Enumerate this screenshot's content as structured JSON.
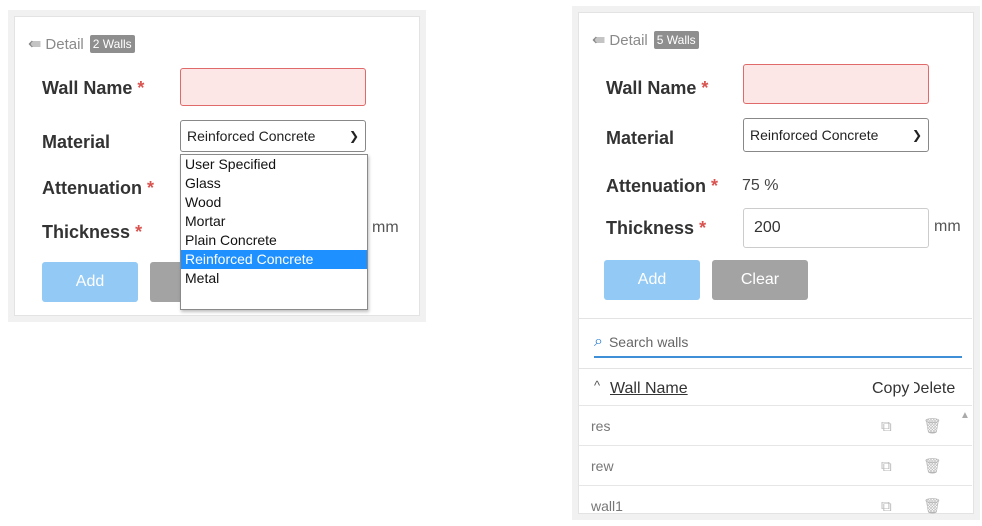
{
  "left": {
    "header": {
      "label": "Detail",
      "badge": "2 Walls"
    },
    "wall_name": {
      "label": "Wall Name",
      "required": "*",
      "value": ""
    },
    "material": {
      "label": "Material",
      "selected": "Reinforced Concrete"
    },
    "attenuation": {
      "label": "Attenuation",
      "required": "*"
    },
    "thickness": {
      "label": "Thickness",
      "required": "*",
      "unit": "mm"
    },
    "buttons": {
      "add": "Add"
    },
    "dropdown_options": [
      "User Specified",
      "Glass",
      "Wood",
      "Mortar",
      "Plain Concrete",
      "Reinforced Concrete",
      "Metal"
    ],
    "highlighted_option": "Reinforced Concrete"
  },
  "right": {
    "header": {
      "label": "Detail",
      "badge": "5 Walls"
    },
    "wall_name": {
      "label": "Wall Name",
      "required": "*",
      "value": ""
    },
    "material": {
      "label": "Material",
      "selected": "Reinforced Concrete"
    },
    "attenuation": {
      "label": "Attenuation",
      "required": "*",
      "value": "75 %"
    },
    "thickness": {
      "label": "Thickness",
      "required": "*",
      "value": "200",
      "unit": "mm"
    },
    "buttons": {
      "add": "Add",
      "clear": "Clear"
    },
    "search": {
      "placeholder": "Search walls"
    },
    "table": {
      "columns": {
        "name": "Wall Name",
        "copy": "Copy",
        "delete": "Delete"
      },
      "sort_indicator": "^",
      "rows": [
        {
          "name": "res"
        },
        {
          "name": "rew"
        },
        {
          "name": "wall1"
        }
      ]
    }
  },
  "colors": {
    "accent": "#3f8fd6",
    "add_button": "#92c9f5",
    "clear_button": "#a3a3a3",
    "error_bg": "#fde6e6",
    "error_border": "#e06a6a",
    "required": "#d9534f",
    "selected_option": "#1e90ff"
  },
  "icons": {
    "back": "collapse-list-icon",
    "search": "search-icon",
    "copy": "copy-icon",
    "delete": "trash-icon",
    "select": "chevron-down-icon",
    "scroll": "scroll-up-arrow-icon"
  }
}
